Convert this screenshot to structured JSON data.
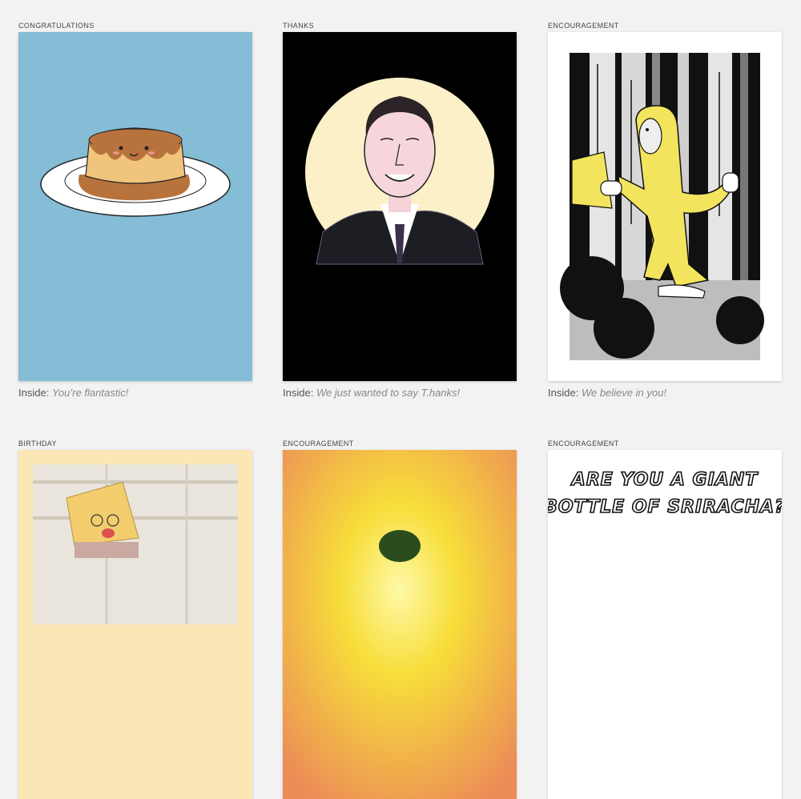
{
  "cards": [
    {
      "category": "CONGRATULATIONS",
      "inside_label": "Inside:",
      "inside_text": "You’re flantastic!",
      "art": "flan-illustration"
    },
    {
      "category": "THANKS",
      "inside_label": "Inside:",
      "inside_text": "We just wanted to say T.hanks!",
      "art": "tom-hanks-portrait"
    },
    {
      "category": "ENCOURAGEMENT",
      "inside_label": "Inside:",
      "inside_text": "We believe in you!",
      "art": "bigfoot-forest"
    },
    {
      "category": "BIRTHDAY",
      "art": "cheese-character"
    },
    {
      "category": "ENCOURAGEMENT",
      "art": "sunburst-avocado"
    },
    {
      "category": "ENCOURAGEMENT",
      "art": "sriracha-lettering",
      "card_text": "ARE YOU A GIANT BOTTLE OF SRIRACHA?",
      "card_line1": "ARE YOU A GIANT",
      "card_line2": "BOTTLE OF SRIRACHA?"
    }
  ],
  "colors": {
    "page_bg": "#f2f2f2",
    "flan_bg": "#85bdd6",
    "thanks_bg": "#000000",
    "bigfoot_yellow": "#f3e45e",
    "birthday_bg": "#fae7b5"
  }
}
